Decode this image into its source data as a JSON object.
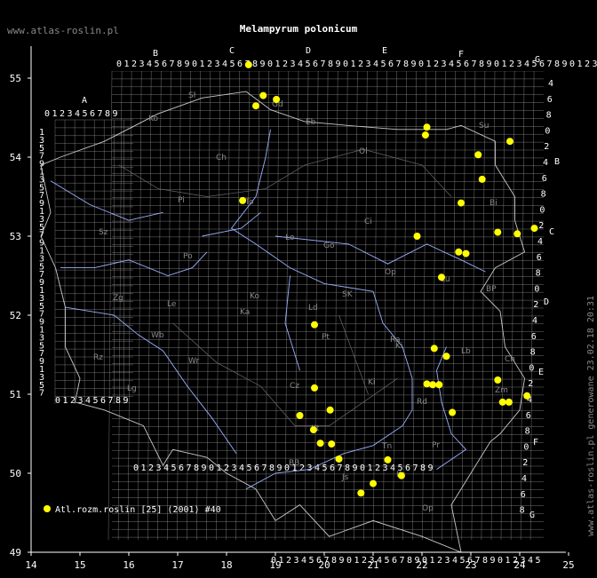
{
  "site_url": "www.atlas-roslin.pl",
  "title": "Melampyrum polonicum",
  "generated": "www.atlas-roslin.pl generowane 23.02.18 20:31",
  "legend": {
    "label": "Atl.rozm.roslin [25] (2001) #40",
    "color": "#ffff00"
  },
  "axes": {
    "lon_ticks": [
      "14",
      "15",
      "16",
      "17",
      "18",
      "19",
      "20",
      "21",
      "22",
      "23",
      "24",
      "25"
    ],
    "lat_ticks": [
      "49",
      "50",
      "51",
      "52",
      "53",
      "54",
      "55"
    ]
  },
  "grid_column_letters": [
    "A",
    "B",
    "C",
    "D",
    "E",
    "F",
    "G"
  ],
  "grid_row_letters": [
    "B",
    "C",
    "D",
    "E",
    "F",
    "G"
  ],
  "grid_digits": "0123456789",
  "right_digits": [
    "4",
    "6",
    "8",
    "0",
    "2",
    "4",
    "6",
    "8",
    "0",
    "2",
    "4",
    "6",
    "8",
    "0",
    "2",
    "4",
    "6",
    "8",
    "0",
    "2",
    "4",
    "6",
    "8",
    "0",
    "2",
    "4",
    "6",
    "8"
  ],
  "regions": [
    "Sł",
    "Ko",
    "Gd",
    "Eb",
    "Ol",
    "Su",
    "Bi",
    "Ch",
    "Pi",
    "To",
    "Ci",
    "Ło",
    "Sz",
    "Go",
    "Po",
    "Ko",
    "Zg",
    "Le",
    "Ka",
    "Ld",
    "Pt",
    "SK",
    "Ra",
    "Lb",
    "Wr",
    "Op",
    "Cz",
    "Ki",
    "Kt",
    "BB",
    "Tn",
    "Kr",
    "Pr",
    "Lu",
    "BP",
    "Ch",
    "Zm",
    "Rd",
    "Ki",
    "Rz",
    "Lg",
    "Wb",
    "Js",
    "Op"
  ],
  "occurrences": [
    {
      "lon": 18.45,
      "lat": 55.17
    },
    {
      "lon": 18.75,
      "lat": 54.78
    },
    {
      "lon": 19.02,
      "lat": 54.73
    },
    {
      "lon": 18.6,
      "lat": 54.65
    },
    {
      "lon": 22.1,
      "lat": 54.38
    },
    {
      "lon": 22.07,
      "lat": 54.28
    },
    {
      "lon": 23.8,
      "lat": 54.2
    },
    {
      "lon": 23.15,
      "lat": 54.03
    },
    {
      "lon": 23.23,
      "lat": 53.72
    },
    {
      "lon": 18.33,
      "lat": 53.45
    },
    {
      "lon": 22.8,
      "lat": 53.42
    },
    {
      "lon": 24.3,
      "lat": 53.1
    },
    {
      "lon": 23.55,
      "lat": 53.05
    },
    {
      "lon": 23.95,
      "lat": 53.03
    },
    {
      "lon": 21.9,
      "lat": 53.0
    },
    {
      "lon": 22.75,
      "lat": 52.8
    },
    {
      "lon": 22.9,
      "lat": 52.78
    },
    {
      "lon": 22.4,
      "lat": 52.48
    },
    {
      "lon": 19.8,
      "lat": 51.88
    },
    {
      "lon": 22.25,
      "lat": 51.58
    },
    {
      "lon": 22.5,
      "lat": 51.48
    },
    {
      "lon": 23.55,
      "lat": 51.18
    },
    {
      "lon": 22.1,
      "lat": 51.13
    },
    {
      "lon": 22.22,
      "lat": 51.12
    },
    {
      "lon": 22.35,
      "lat": 51.12
    },
    {
      "lon": 19.8,
      "lat": 51.08
    },
    {
      "lon": 24.15,
      "lat": 50.98
    },
    {
      "lon": 23.65,
      "lat": 50.9
    },
    {
      "lon": 23.78,
      "lat": 50.9
    },
    {
      "lon": 20.12,
      "lat": 50.8
    },
    {
      "lon": 22.62,
      "lat": 50.77
    },
    {
      "lon": 19.5,
      "lat": 50.73
    },
    {
      "lon": 19.78,
      "lat": 50.55
    },
    {
      "lon": 19.92,
      "lat": 50.38
    },
    {
      "lon": 20.15,
      "lat": 50.37
    },
    {
      "lon": 20.3,
      "lat": 50.18
    },
    {
      "lon": 21.3,
      "lat": 50.17
    },
    {
      "lon": 21.58,
      "lat": 49.97
    },
    {
      "lon": 21.0,
      "lat": 49.87
    },
    {
      "lon": 20.75,
      "lat": 49.75
    }
  ]
}
